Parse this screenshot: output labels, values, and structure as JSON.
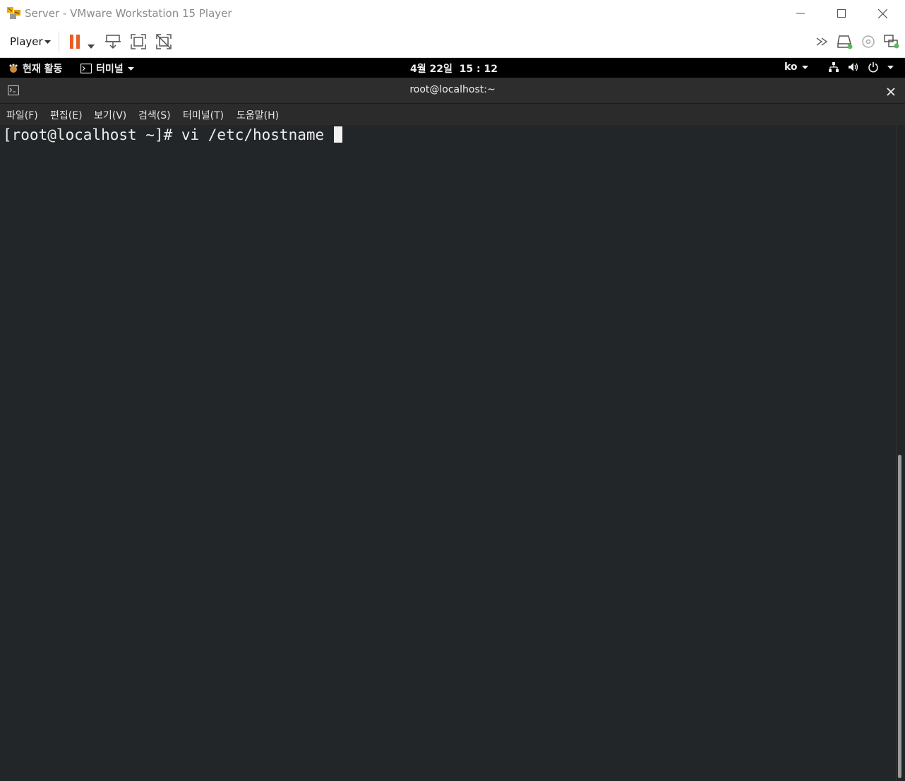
{
  "window": {
    "title": "Server - VMware Workstation 15 Player",
    "icon": "vmware-logo-icon",
    "controls": [
      "minimize-icon",
      "maximize-icon",
      "close-icon"
    ]
  },
  "toolbar": {
    "player_label": "Player",
    "icons": [
      "pause-icon",
      "dropdown-arrow-icon",
      "send-ctrl-alt-del-icon",
      "fullscreen-icon",
      "unity-icon",
      "more-devices-icon",
      "hard-disk-icon",
      "cd-dvd-icon",
      "network-adapter-icon"
    ],
    "accent": "#e85d24"
  },
  "gnome": {
    "activities": "현재 활동",
    "app_menu": "터미널",
    "clock": "4월 22일  15 : 12",
    "input_method": "ko",
    "tray_icons": [
      "network-icon",
      "volume-icon",
      "power-icon"
    ]
  },
  "terminal": {
    "title": "root@localhost:~",
    "menu": [
      "파일(F)",
      "편집(E)",
      "보기(V)",
      "검색(S)",
      "터미널(T)",
      "도움말(H)"
    ],
    "prompt": "[root@localhost ~]# vi /etc/hostname ",
    "background": "#232629"
  },
  "scrollbar": {
    "position": 0.52
  }
}
